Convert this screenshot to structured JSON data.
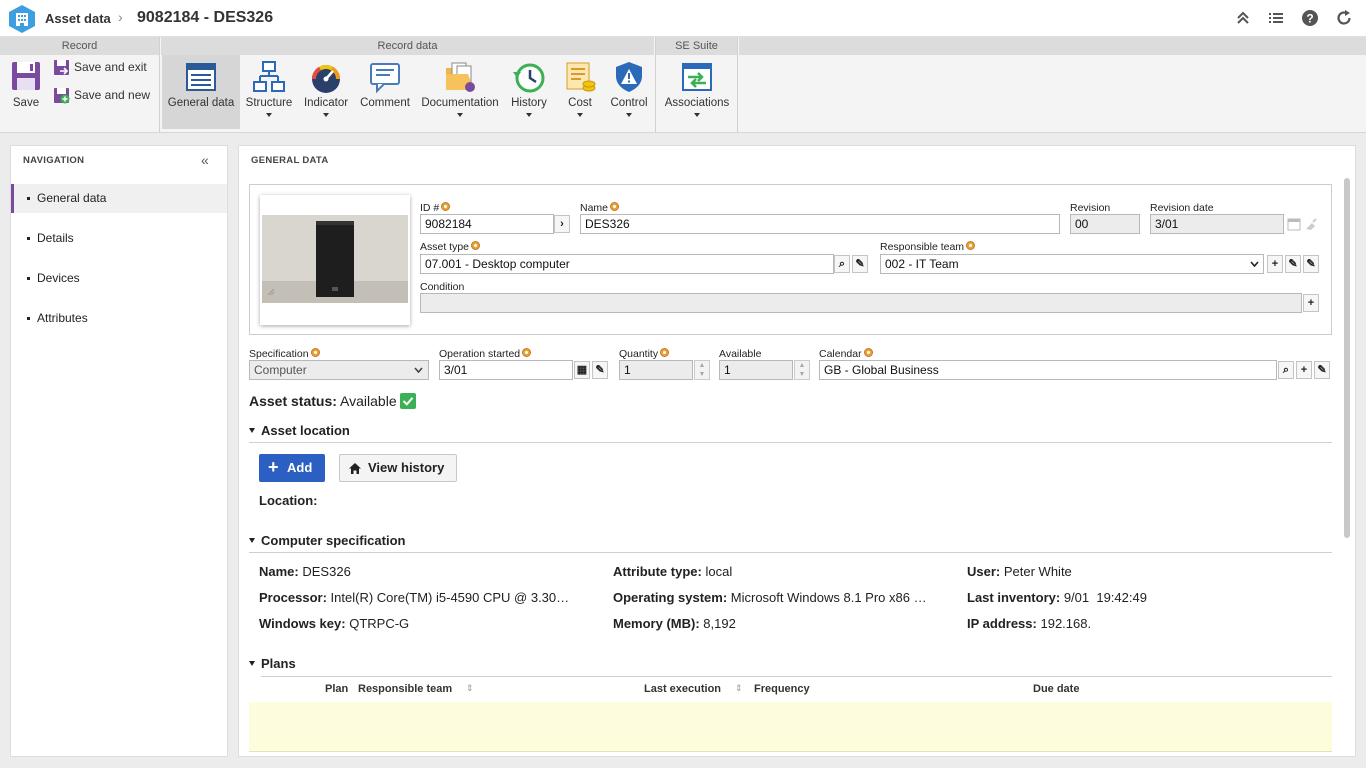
{
  "header": {
    "app_title": "Asset data",
    "record_title": "9082184 - DES326"
  },
  "ribbon": {
    "groups": {
      "record": "Record",
      "record_data": "Record data",
      "se_suite": "SE Suite"
    },
    "save": "Save",
    "save_and_exit": "Save and exit",
    "save_and_new": "Save and new",
    "buttons": {
      "general_data": "General data",
      "structure": "Structure",
      "indicator": "Indicator",
      "comment": "Comment",
      "documentation": "Documentation",
      "history": "History",
      "cost": "Cost",
      "control": "Control",
      "associations": "Associations"
    }
  },
  "navigation": {
    "title": "NAVIGATION",
    "items": [
      "General data",
      "Details",
      "Devices",
      "Attributes"
    ]
  },
  "main": {
    "title": "GENERAL DATA",
    "fields": {
      "id_label": "ID #",
      "id_value": "9082184",
      "name_label": "Name",
      "name_value": "DES326",
      "revision_label": "Revision",
      "revision_value": "00",
      "revision_date_label": "Revision date",
      "revision_date_value": "3/01",
      "asset_type_label": "Asset type",
      "asset_type_value": "07.001 - Desktop computer",
      "resp_team_label": "Responsible team",
      "resp_team_value": "002 - IT Team",
      "condition_label": "Condition",
      "condition_value": "",
      "specification_label": "Specification",
      "specification_value": "Computer",
      "operation_started_label": "Operation started",
      "operation_started_value": "3/01",
      "quantity_label": "Quantity",
      "quantity_value": "1",
      "available_label": "Available",
      "available_value": "1",
      "calendar_label": "Calendar",
      "calendar_value": "GB - Global Business"
    },
    "asset_status_label": "Asset status:",
    "asset_status_value": "Available",
    "asset_location": {
      "title": "Asset location",
      "add_label": "Add",
      "view_history_label": "View history",
      "location_label": "Location:"
    },
    "computer_spec": {
      "title": "Computer specification",
      "name_label": "Name:",
      "name_value": "DES326",
      "processor_label": "Processor:",
      "processor_value": "Intel(R) Core(TM) i5-4590 CPU @ 3.30…",
      "windows_key_label": "Windows key:",
      "windows_key_value": "QTRPC-G",
      "attr_type_label": "Attribute type:",
      "attr_type_value": "local",
      "os_label": "Operating system:",
      "os_value": "Microsoft Windows 8.1 Pro x86 …",
      "memory_label": "Memory (MB):",
      "memory_value": "8,192",
      "user_label": "User:",
      "user_value": "Peter White",
      "last_inventory_label": "Last inventory:",
      "last_inventory_value": "9/01  19:42:49",
      "ip_label": "IP address:",
      "ip_value": "192.168."
    },
    "plans": {
      "title": "Plans",
      "columns": {
        "plan": "Plan",
        "resp_team": "Responsible team",
        "last_exec": "Last execution",
        "frequency": "Frequency",
        "due_date": "Due date"
      }
    }
  },
  "colors": {
    "accent": "#7a4a9e",
    "add_button": "#2b5fc2",
    "status_green": "#3cb054",
    "plans_empty": "#fdfcdc"
  }
}
